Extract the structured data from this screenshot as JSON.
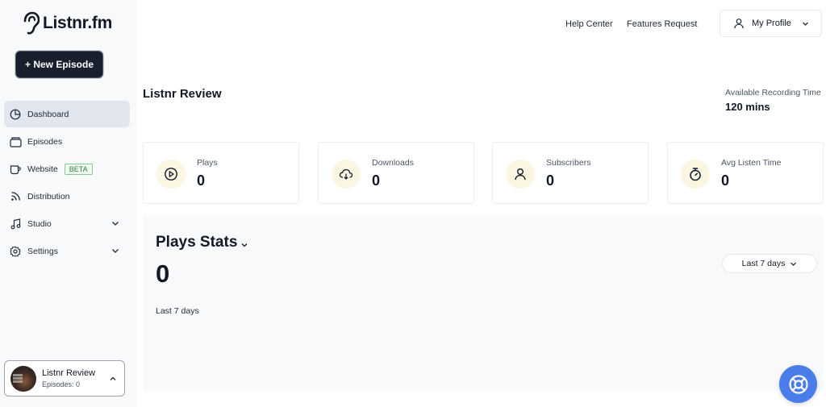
{
  "brand": {
    "name": "Listnr.fm"
  },
  "sidebar": {
    "new_episode_label": "+ New Episode",
    "items": [
      {
        "label": "Dashboard",
        "icon": "pie-chart-icon",
        "active": true
      },
      {
        "label": "Episodes",
        "icon": "folder-icon"
      },
      {
        "label": "Website",
        "icon": "mug-icon",
        "badge": "BETA"
      },
      {
        "label": "Distribution",
        "icon": "rss-icon"
      },
      {
        "label": "Studio",
        "icon": "music-note-icon",
        "expandable": true
      },
      {
        "label": "Settings",
        "icon": "gear-icon",
        "expandable": true
      }
    ],
    "podcast": {
      "title": "Listnr Review",
      "subtitle": "Episodes: 0"
    }
  },
  "header": {
    "help_center": "Help Center",
    "features_request": "Features Request",
    "profile_label": "My Profile"
  },
  "main": {
    "title": "Listnr Review",
    "recording": {
      "label": "Available Recording Time",
      "value": "120 mins"
    },
    "stats": [
      {
        "label": "Plays",
        "value": "0",
        "icon": "play-circle-icon"
      },
      {
        "label": "Downloads",
        "value": "0",
        "icon": "cloud-download-icon"
      },
      {
        "label": "Subscribers",
        "value": "0",
        "icon": "user-icon"
      },
      {
        "label": "Avg Listen Time",
        "value": "0",
        "icon": "stopwatch-icon"
      }
    ],
    "plays_panel": {
      "title": "Plays Stats",
      "value": "0",
      "period": "Last 7 days",
      "range_selected": "Last 7 days"
    }
  },
  "colors": {
    "primary_dark": "#1a1f2e",
    "accent_blue": "#4a7dea",
    "icon_bg": "#fbf6e2",
    "beta_green": "#2f7d3a"
  }
}
